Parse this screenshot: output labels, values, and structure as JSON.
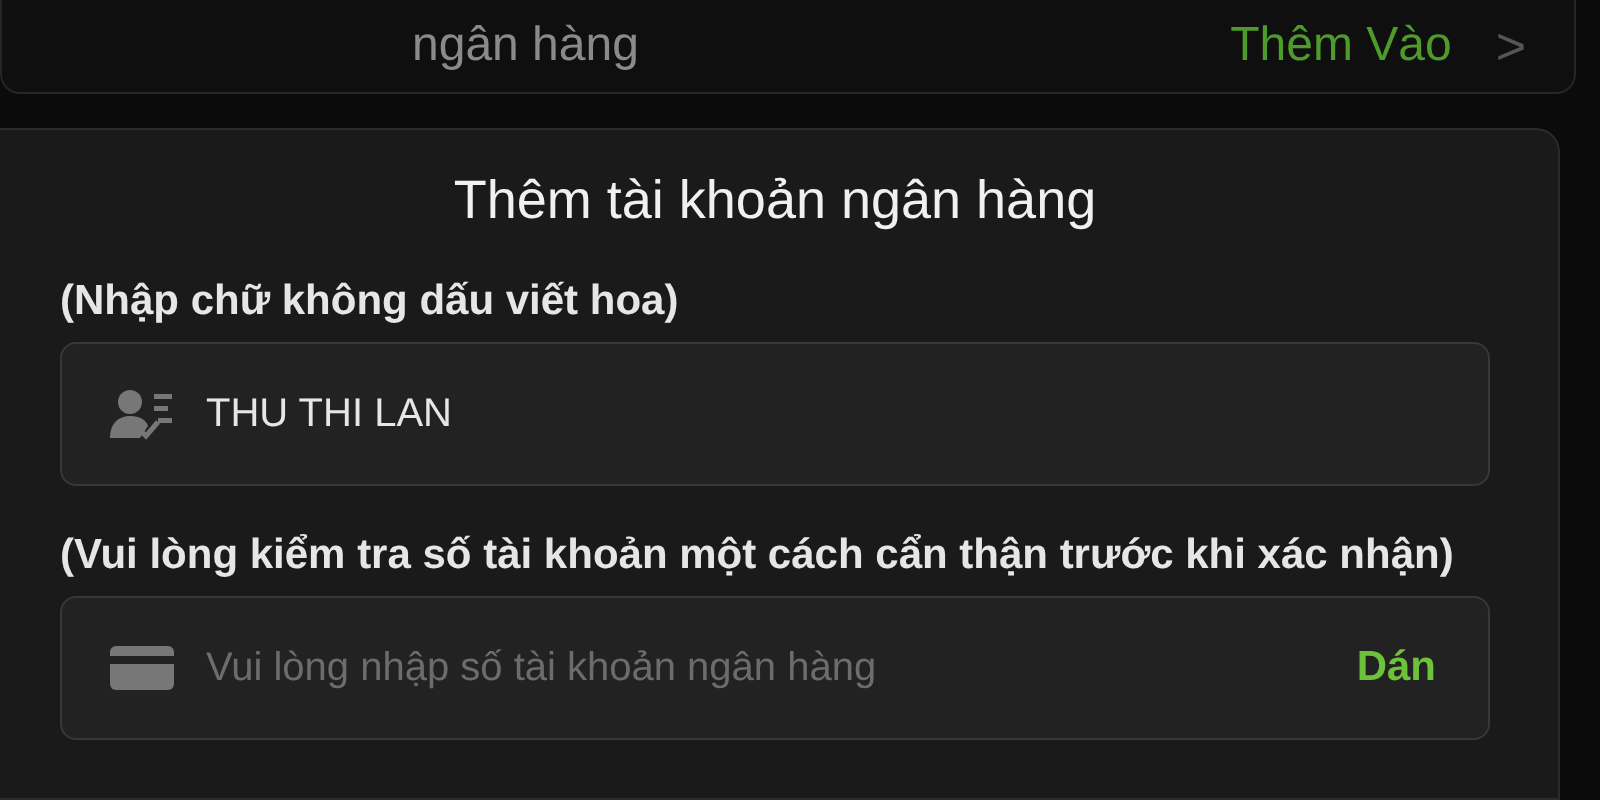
{
  "bank_row": {
    "label": "ngân hàng",
    "action": "Thêm Vào",
    "chevron": ">"
  },
  "dialog": {
    "title": "Thêm tài khoản ngân hàng",
    "fields": [
      {
        "kind": "name",
        "hint": "(Nhập chữ không dấu viết hoa)",
        "value": "THU THI LAN"
      },
      {
        "kind": "card",
        "hint": "(Vui lòng kiểm tra số tài khoản một cách cẩn thận trước khi xác nhận)",
        "placeholder": "Vui lòng nhập số tài khoản ngân hàng",
        "paste": "Dán"
      }
    ]
  }
}
